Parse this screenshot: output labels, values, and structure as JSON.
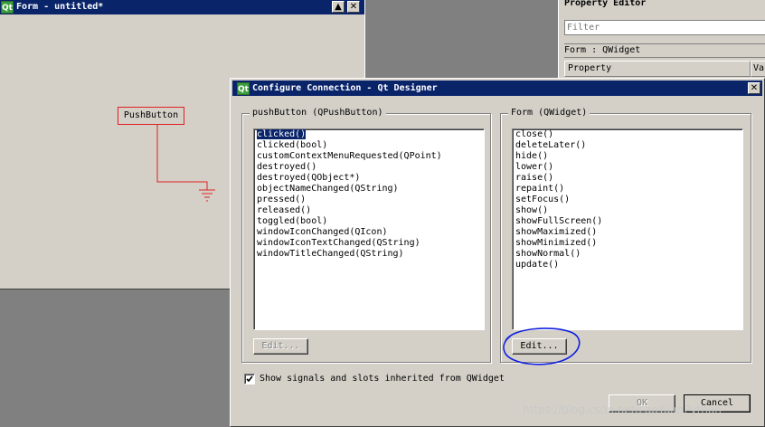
{
  "form_window": {
    "title": "Form - untitled*",
    "qt_badge": "Qt",
    "minimize_glyph": "▲",
    "close_glyph": "✕",
    "pushbutton_label": "PushButton"
  },
  "property_editor": {
    "title": "Property Editor",
    "filter_placeholder": "Filter",
    "object_label": "Form : QWidget",
    "col_property": "Property",
    "col_value": "Va"
  },
  "dialog": {
    "title": "Configure Connection - Qt Designer",
    "qt_badge": "Qt",
    "close_glyph": "✕",
    "left_group": {
      "label": "pushButton (QPushButton)",
      "items": [
        "clicked()",
        "clicked(bool)",
        "customContextMenuRequested(QPoint)",
        "destroyed()",
        "destroyed(QObject*)",
        "objectNameChanged(QString)",
        "pressed()",
        "released()",
        "toggled(bool)",
        "windowIconChanged(QIcon)",
        "windowIconTextChanged(QString)",
        "windowTitleChanged(QString)"
      ],
      "edit_label": "Edit..."
    },
    "right_group": {
      "label": "Form (QWidget)",
      "items": [
        "close()",
        "deleteLater()",
        "hide()",
        "lower()",
        "raise()",
        "repaint()",
        "setFocus()",
        "show()",
        "showFullScreen()",
        "showMaximized()",
        "showMinimized()",
        "showNormal()",
        "update()"
      ],
      "edit_label": "Edit..."
    },
    "show_inherited_label": "Show signals and slots inherited from QWidget",
    "show_inherited_checked": true,
    "ok_label": "OK",
    "cancel_label": "Cancel"
  },
  "watermark": "https://blog.csdn.net/LaoYuanPython",
  "colors": {
    "title_bar": "#0a246a",
    "annotation": "#1020e0",
    "connection": "#e02020"
  }
}
